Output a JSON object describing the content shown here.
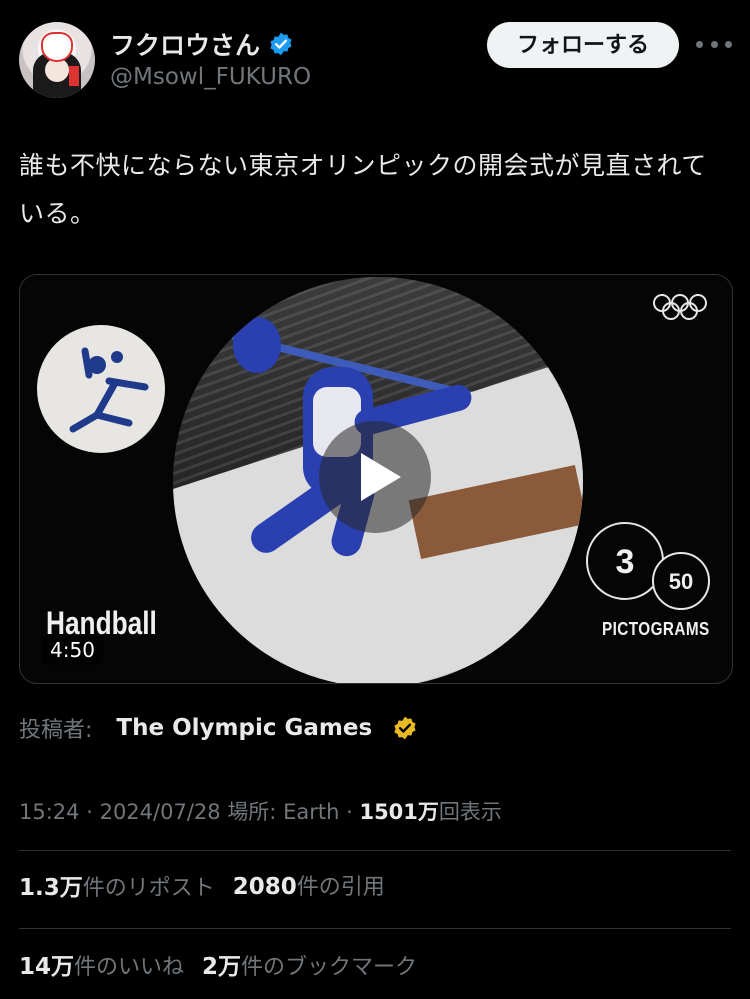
{
  "author": {
    "name": "フクロウさん",
    "handle": "@Msowl_FUKURO",
    "verified_color": "#1d9bf0"
  },
  "header": {
    "follow_label": "フォローする"
  },
  "tweet": {
    "text": "誰も不快にならない東京オリンピックの開会式が見直されている。"
  },
  "media": {
    "sport_label": "Handball",
    "counter_current": "3",
    "counter_total": "50",
    "counter_label": "PICTOGRAMS",
    "duration": "4:50",
    "accent_color": "#2a3fb0"
  },
  "source": {
    "label": "投稿者:",
    "name": "The Olympic Games",
    "badge_color": "#e8b923"
  },
  "meta": {
    "time": "15:24",
    "date": "2024/07/28",
    "location_label": "場所:",
    "location": "Earth",
    "views": "1501万",
    "views_suffix": "回表示"
  },
  "stats": {
    "reposts_count": "1.3万",
    "reposts_label": "件のリポスト",
    "quotes_count": "2080",
    "quotes_label": "件の引用",
    "likes_count": "14万",
    "likes_label": "件のいいね",
    "bookmarks_count": "2万",
    "bookmarks_label": "件のブックマーク"
  }
}
